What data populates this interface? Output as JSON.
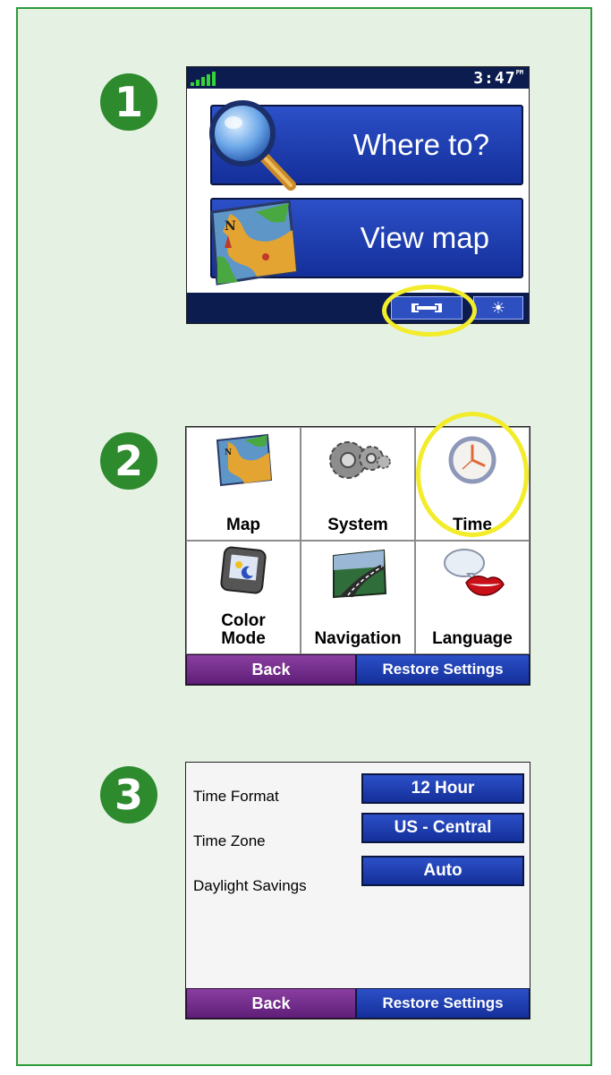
{
  "steps": [
    "1",
    "2",
    "3"
  ],
  "screen1": {
    "clock": "3:47",
    "clock_suffix": "PM",
    "where_to_label": "Where to?",
    "view_map_label": "View map",
    "tools_glyph": "⊶",
    "brightness_glyph": "☀",
    "icons": [
      "magnifier-icon",
      "map-icon",
      "wrench-icon",
      "brightness-icon"
    ],
    "highlight": "tools-button"
  },
  "screen2": {
    "items": [
      {
        "label": "Map",
        "icon": "map-icon"
      },
      {
        "label": "System",
        "icon": "gears-icon"
      },
      {
        "label": "Time",
        "icon": "clock-icon"
      },
      {
        "label": "Color Mode",
        "label_line1": "Color",
        "label_line2": "Mode",
        "icon": "color-mode-icon"
      },
      {
        "label": "Navigation",
        "icon": "road-icon"
      },
      {
        "label": "Language",
        "icon": "speech-lips-icon"
      }
    ],
    "back_label": "Back",
    "restore_label": "Restore Settings",
    "highlight": "Time"
  },
  "screen3": {
    "rows": [
      {
        "label": "Time Format",
        "value": "12 Hour"
      },
      {
        "label": "Time Zone",
        "value": "US - Central"
      },
      {
        "label": "Daylight Savings",
        "value": "Auto"
      }
    ],
    "back_label": "Back",
    "restore_label": "Restore Settings"
  },
  "colors": {
    "panel_bg": "#e5f2e3",
    "panel_border": "#2e9a3b",
    "step_badge": "#2d8a2d",
    "highlight_ring": "#f2ec2a",
    "button_blue": "#1f3fb5",
    "button_purple": "#7a2f92"
  }
}
